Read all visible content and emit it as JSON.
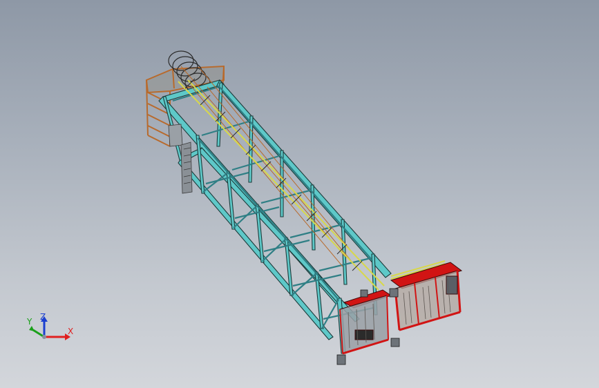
{
  "viewport": {
    "background_top": "#8e98a6",
    "background_bottom": "#d3d6db"
  },
  "model": {
    "frame_color": "#5ec8c8",
    "frame_edge_color": "#1c3a3a",
    "platform_color": "#d11414",
    "ladder_color": "#b86a2c",
    "rail_color": "#d8d84a",
    "cage_color": "#2b2b2b"
  },
  "triad": {
    "x_label": "X",
    "y_label": "Y",
    "z_label": "Z",
    "x_color": "#e02020",
    "y_color": "#1aa01a",
    "z_color": "#1b3fd0"
  }
}
